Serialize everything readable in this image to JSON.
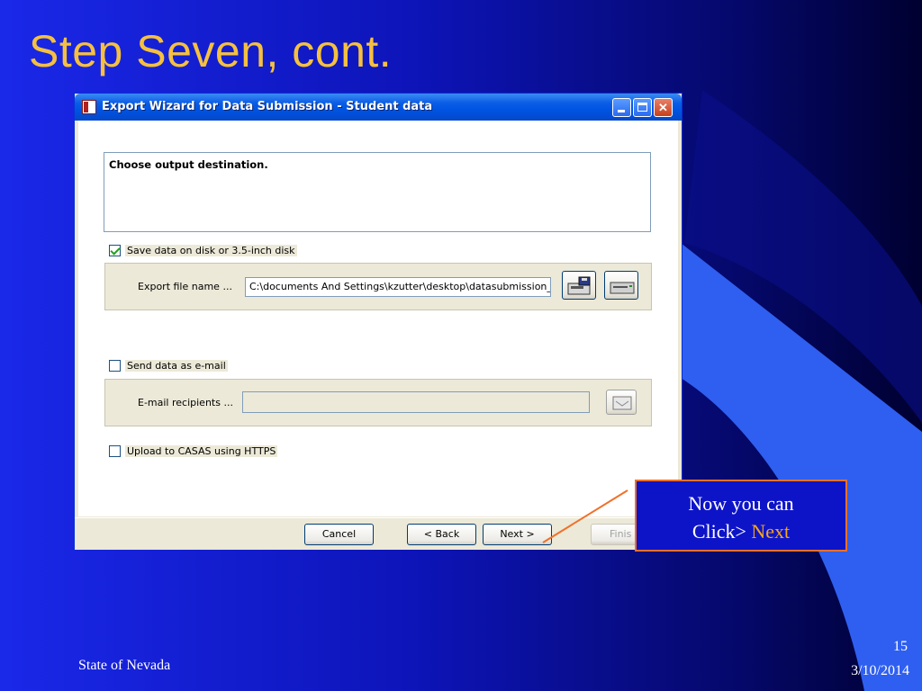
{
  "slide": {
    "title": "Step Seven, cont.",
    "footer_left": "State of Nevada",
    "slide_number": "15",
    "date": "3/10/2014"
  },
  "dialog": {
    "title": "Export Wizard for Data Submission - Student data",
    "instruction": "Choose output destination.",
    "save_disk": {
      "label": "Save data on disk or 3.5-inch disk",
      "checked": true
    },
    "export_file": {
      "label": "Export file name ...",
      "value": "C:\\documents And Settings\\kzutter\\desktop\\datasubmission_"
    },
    "send_email": {
      "label": "Send data as e-mail",
      "checked": false
    },
    "email_recipients": {
      "label": "E-mail recipients ...",
      "value": ""
    },
    "upload_https": {
      "label": "Upload to CASAS using HTTPS",
      "checked": false
    },
    "buttons": {
      "cancel": "Cancel",
      "back": "< Back",
      "next": "Next >",
      "finish": "Finis"
    },
    "icons": [
      "save-file-icon",
      "disk-drive-icon",
      "address-book-icon"
    ]
  },
  "callout": {
    "line1": "Now you can",
    "line2_prefix": "Click>",
    "line2_highlight": "Next"
  },
  "colors": {
    "title": "#f5c040",
    "callout_border": "#f07028",
    "callout_highlight": "#f5a623"
  }
}
